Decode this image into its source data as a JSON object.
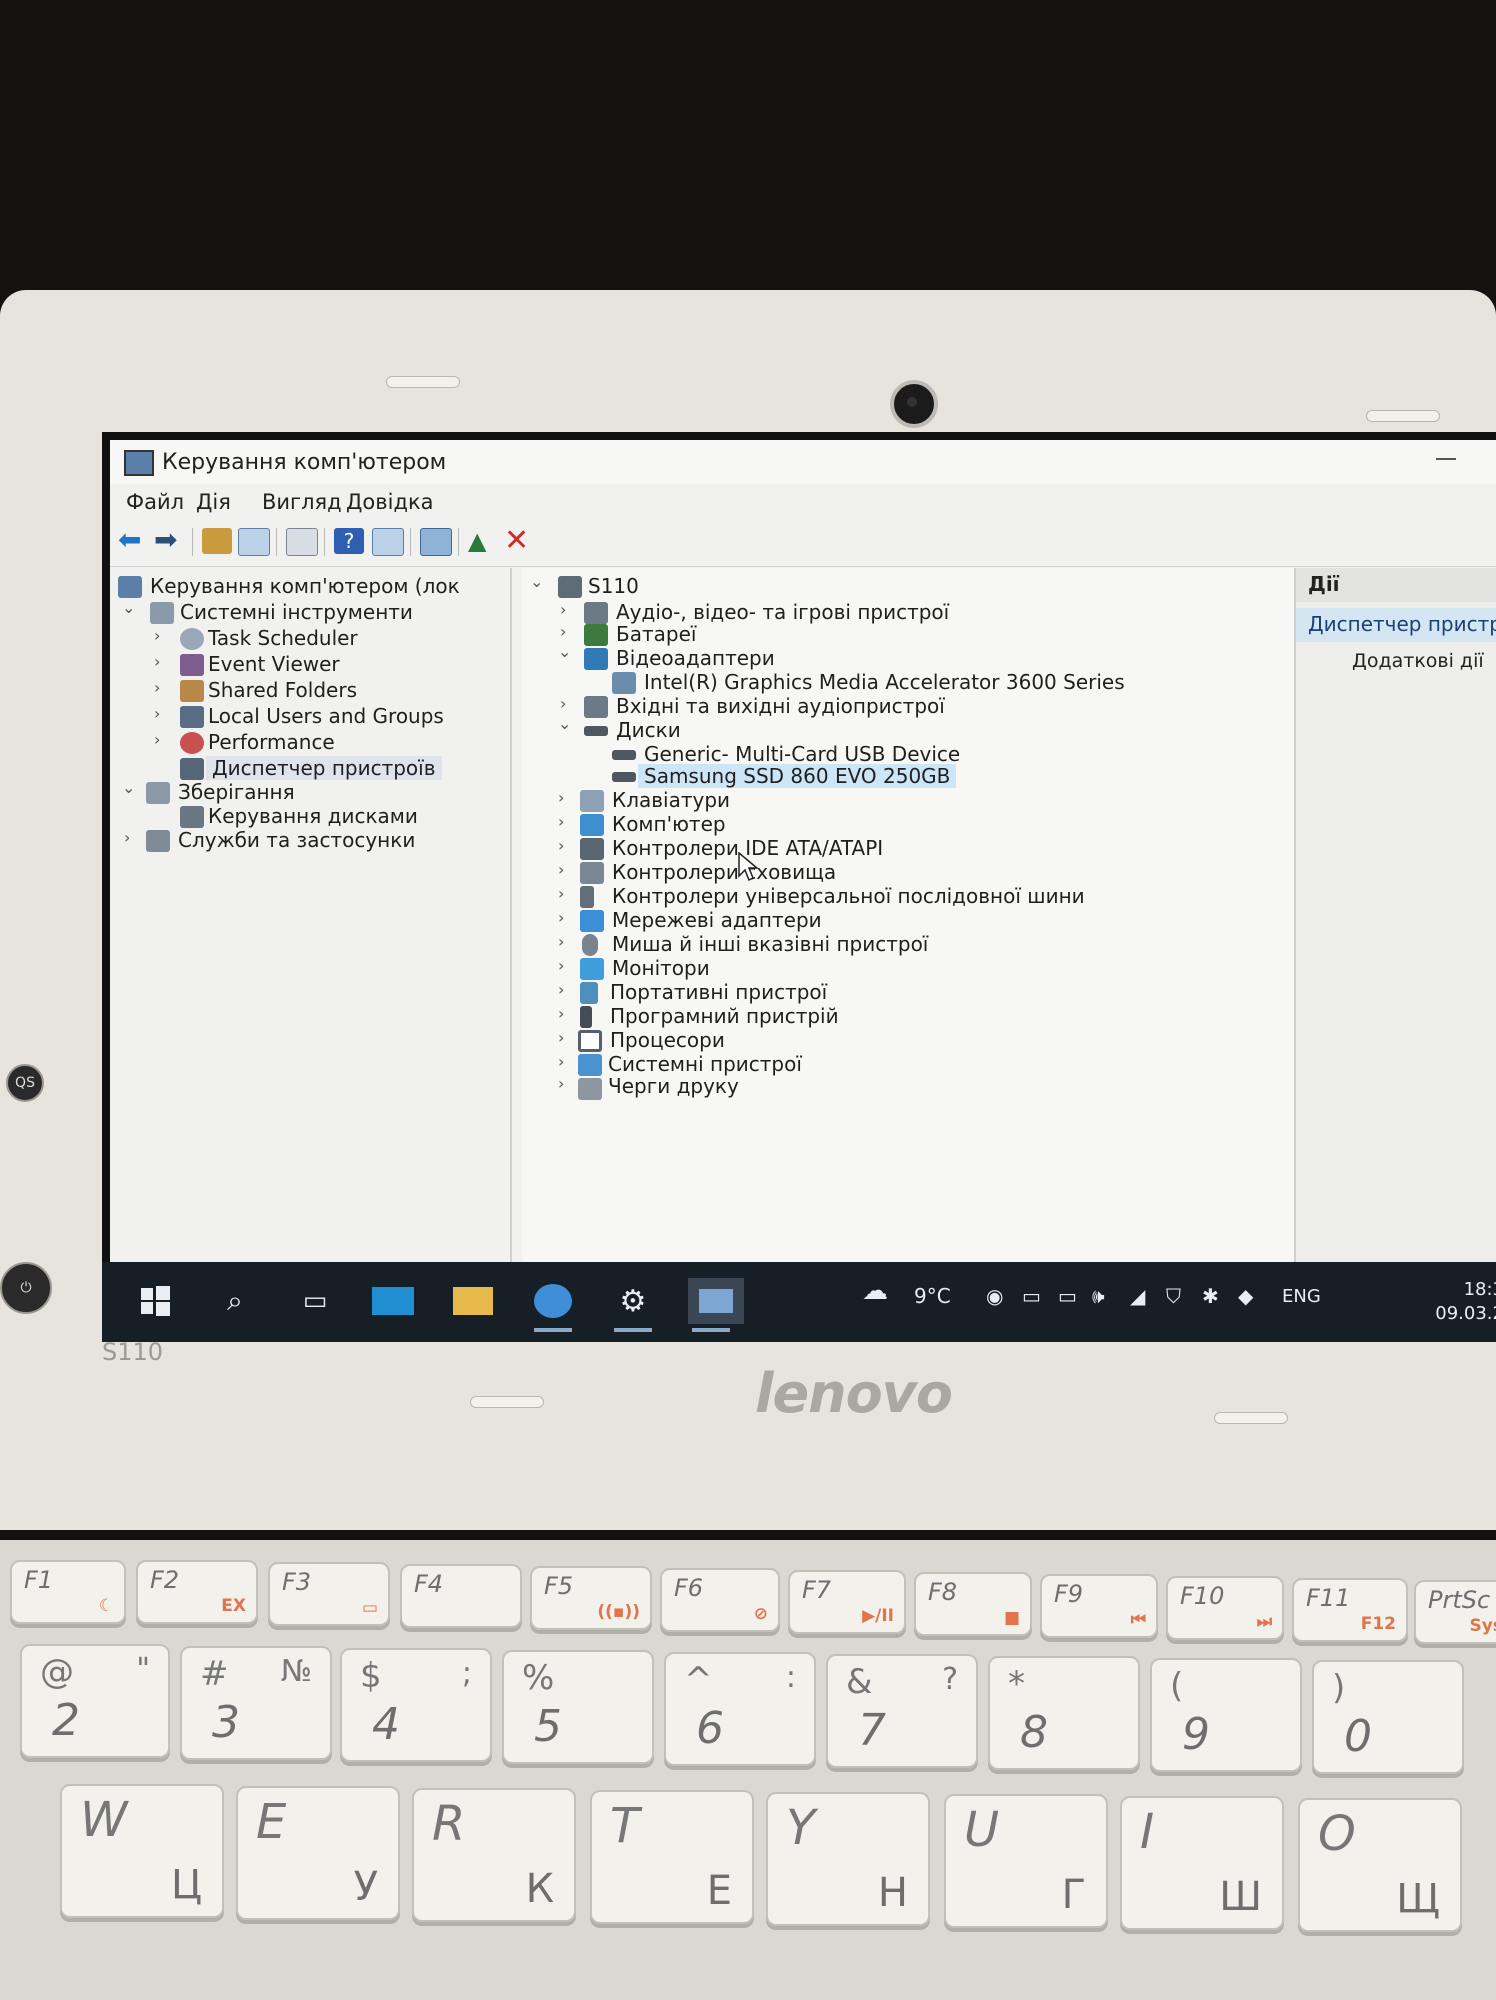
{
  "window": {
    "title": "Керування комп'ютером",
    "menu": [
      "Файл",
      "Дія",
      "Вигляд",
      "Довідка"
    ]
  },
  "tree": {
    "root": "Керування комп'ютером (лок",
    "system_tools": "Системні інструменти",
    "task_scheduler": "Task Scheduler",
    "event_viewer": "Event Viewer",
    "shared_folders": "Shared Folders",
    "local_users": "Local Users and Groups",
    "performance": "Performance",
    "device_manager": "Диспетчер пристроїв",
    "storage": "Зберігання",
    "disk_management": "Керування дисками",
    "services": "Служби та застосунки"
  },
  "devices": {
    "computer_name": "S110",
    "audio_video": "Аудіо-, відео- та ігрові пристрої",
    "batteries": "Батареї",
    "video_adapters": "Відеоадаптери",
    "intel_gma": "Intel(R) Graphics Media Accelerator 3600 Series",
    "audio_io": "Вхідні та вихідні аудіопристрої",
    "disks": "Диски",
    "generic_card": "Generic- Multi-Card USB Device",
    "samsung_ssd": "Samsung SSD 860 EVO 250GB",
    "keyboards": "Клавіатури",
    "computer": "Комп'ютер",
    "ide": "Контролери IDE ATA/ATAPI",
    "storage_ctrl": "Контролери сховища",
    "usb": "Контролери універсальної послідовної шини",
    "network": "Мережеві адаптери",
    "mice": "Миша й інші вказівні пристрої",
    "monitors": "Монітори",
    "portable": "Портативні пристрої",
    "software": "Програмний пристрій",
    "processors": "Процесори",
    "system": "Системні пристрої",
    "print_queues": "Черги друку"
  },
  "actions": {
    "header": "Дії",
    "selected": "Диспетчер пристр",
    "more": "Додаткові дії"
  },
  "taskbar": {
    "weather": "9°C",
    "language": "ENG",
    "time": "18:3",
    "date": "09.03.2"
  },
  "laptop": {
    "model": "S110",
    "brand": "lenovo",
    "qs_label": "QS"
  },
  "keys": {
    "f1": "F1",
    "f2": "F2",
    "f2_sub": "EX",
    "f3": "F3",
    "f4": "F4",
    "f5": "F5",
    "f6": "F6",
    "f7": "F7",
    "f7_sub": "▶/II",
    "f8": "F8",
    "f8_sub": "■",
    "f9": "F9",
    "f9_sub": "⏮",
    "f10": "F10",
    "f10_sub": "⏭",
    "f11": "F11",
    "f11_sub": "F12",
    "prtsc": "PrtSc",
    "prtsc_sub": "SysR",
    "n2_top": "@",
    "n2_top2": "\"",
    "n2": "2",
    "n3_top": "#",
    "n3_top2": "№",
    "n3": "3",
    "n4_top": "$",
    "n4_top2": ";",
    "n4": "4",
    "n5_top": "%",
    "n5": "5",
    "n6_top": "^",
    "n6_top2": ":",
    "n6": "6",
    "n7_top": "&",
    "n7_top2": "?",
    "n7": "7",
    "n8_top": "*",
    "n8": "8",
    "n9_top": "(",
    "n9": "9",
    "n0_top": ")",
    "n0": "0",
    "w": "W",
    "w_cyr": "Ц",
    "e": "E",
    "e_cyr": "У",
    "r": "R",
    "r_cyr": "К",
    "t": "T",
    "t_cyr": "Е",
    "y": "Y",
    "y_cyr": "Н",
    "u": "U",
    "u_cyr": "Г",
    "i": "I",
    "i_cyr": "Ш",
    "o": "O",
    "o_cyr": "Щ"
  }
}
